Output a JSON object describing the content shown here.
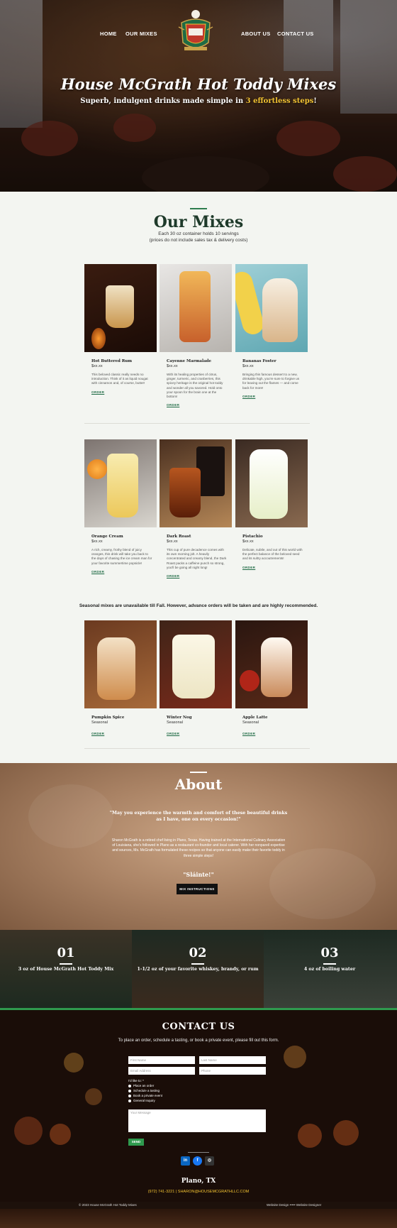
{
  "nav": {
    "home": "HOME",
    "our_mixes": "OUR MIXES",
    "about_us": "ABOUT US",
    "contact_us": "CONTACT US"
  },
  "hero": {
    "title": "House McGrath Hot Toddy Mixes",
    "subtitle_prefix": "Superb, indulgent drinks made simple in ",
    "subtitle_highlight": "3 effortless steps",
    "subtitle_suffix": "!",
    "highlight_color": "#f1c232"
  },
  "mixes": {
    "title": "Our Mixes",
    "note1": "Each 30 oz container holds 10 servings",
    "note2": "(prices do not include sales tax & delivery costs)",
    "items": [
      {
        "name": "Hot Buttered Rum",
        "price": "$xx.xx",
        "desc": "This beloved classic really needs no introduction. Think of it as liquid nougat with cinnamon and, of course, butter!",
        "order": "ORDER"
      },
      {
        "name": "Cayenne Marmalade",
        "price": "$xx.xx",
        "desc": "With its healing properties of citrus, ginger, turmeric, and cranberries, this spicey heritage is the original hot toddy and wonder all you savored. Hold onto your spoon for the brain one at the bottom!",
        "order": "ORDER"
      },
      {
        "name": "Bananas Foster",
        "price": "$xx.xx",
        "desc": "Bringing this famous dessert to a new, drinkable high, you're sure to forgive us for leaving out the flames — and come back for more!",
        "order": "ORDER"
      },
      {
        "name": "Orange Cream",
        "price": "$xx.xx",
        "desc": "A rich, creamy, frothy blend of juicy oranges, this drink will take you back to the days of chasing the ice cream man for your favorite summertime popsicle!",
        "order": "ORDER"
      },
      {
        "name": "Dark Roast",
        "price": "$xx.xx",
        "desc": "This cup of pure decadence comes with its own morning jolt. A heavily concentrated and creamy blend, the Dark Roast packs a caffeine punch so strong, you'll be going all night long!",
        "order": "ORDER"
      },
      {
        "name": "Pistachio",
        "price": "$xx.xx",
        "desc": "Delicate, subtle, and out of this world with the perfect balance of the beloved seed and its sultry accoutrements!",
        "order": "ORDER"
      }
    ],
    "seasonal_note": "Seasonal mixes are unavailable till Fall. However, advance orders will be taken and are highly recommended.",
    "seasonal": [
      {
        "name": "Pumpkin Spice",
        "price": "Seasonal",
        "order": "ORDER"
      },
      {
        "name": "Winter Nog",
        "price": "Seasonal",
        "order": "ORDER"
      },
      {
        "name": "Apple Latte",
        "price": "Seasonal",
        "order": "ORDER"
      }
    ]
  },
  "about": {
    "title": "About",
    "quote": "\"May you experience the warmth and comfort of these beautiful drinks as I have, one on every occasion!\"",
    "body": "Sharon McGrath is a retired chef living in Plano, Texas. Having trained at the International Culinary Association of Louisiana, she's followed in Plano as a restaurant co-founder and local caterer. With her nonpareil expertise and sources, Ms. McGrath has formulated these recipes so that anyone can easily make their favorite toddy in three simple steps!",
    "slainte": "\"Sláinte!\"",
    "button": "MIX INSTRUCTIONS"
  },
  "steps": [
    {
      "num": "01",
      "text": "3 oz of House McGrath Hot Toddy Mix"
    },
    {
      "num": "02",
      "text": "1-1/2 oz of your favorite whiskey, brandy, or rum"
    },
    {
      "num": "03",
      "text": "4 oz of boiling water"
    }
  ],
  "contact": {
    "title": "CONTACT US",
    "intro": "To place an order, schedule a tasting, or book a private event, please fill out this form.",
    "first_name": "First Name",
    "last_name": "Last Name",
    "email": "Email Address",
    "phone": "Phone",
    "like_to": "I'd like to: *",
    "options": [
      "Place an order",
      "Schedule a tasting",
      "Book a private event",
      "General Inquiry"
    ],
    "message": "Your Message",
    "send": "SEND",
    "city": "Plano, TX",
    "contact_line": "(972) 741-3221 | SHARON@HOUSEMCGRATHLLC.COM",
    "accent": "#2f9a4e"
  },
  "footer": {
    "copyright": "© 2023 House McGrath Hot Toddy Mixes",
    "design": "Website Design ••••• Website Designer"
  },
  "social": {
    "linkedin": "in",
    "facebook": "f",
    "instagram": "◎"
  }
}
